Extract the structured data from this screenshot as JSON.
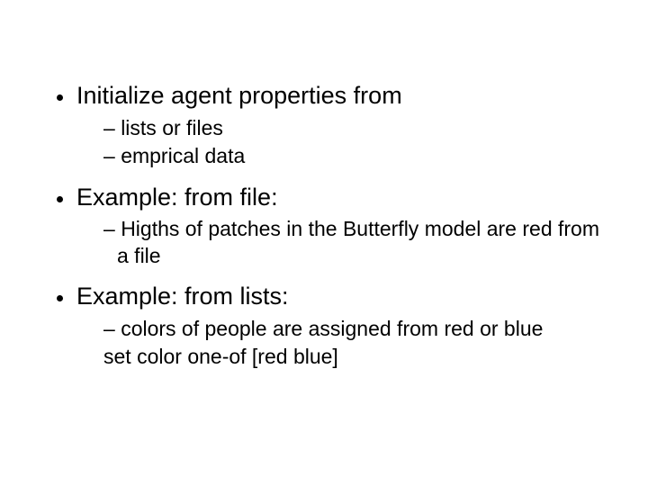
{
  "bullets": [
    {
      "text": "Initialize agent properties from",
      "sub": [
        {
          "kind": "dashed",
          "text": "lists or files"
        },
        {
          "kind": "dashed",
          "text": "emprical data"
        }
      ]
    },
    {
      "text": "Example: from file:",
      "sub": [
        {
          "kind": "dashed",
          "text": "Higths of patches in the Butterfly model are red from a file"
        }
      ]
    },
    {
      "text": "Example: from lists:",
      "sub": [
        {
          "kind": "dashed",
          "text": "colors of  people are assigned from red or blue"
        },
        {
          "kind": "plain",
          "text": "set color one-of [red blue]"
        }
      ]
    }
  ]
}
